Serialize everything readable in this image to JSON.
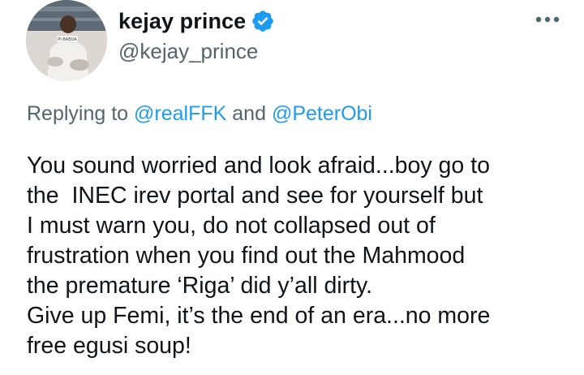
{
  "author": {
    "display_name": "kejay prince",
    "handle": "@kejay_prince",
    "verified": true,
    "verified_color": "#1d9bf0",
    "avatar_label": "PI-BABUA"
  },
  "more_menu": {
    "icon": "more-horizontal-icon"
  },
  "reply": {
    "prefix": "Replying to ",
    "mention_1": "@realFFK",
    "joiner": " and ",
    "mention_2": "@PeterObi",
    "mention_color": "#1d9bf0"
  },
  "tweet": {
    "lines": [
      "You sound worried and look afraid...boy go to",
      "the  INEC irev portal and see for yourself but",
      "I must warn you, do not collapsed out of",
      "frustration when you find out the Mahmood",
      "the premature ‘Riga’ did y’all dirty.",
      "Give up Femi, it’s the end of an era...no more",
      "free egusi soup!"
    ]
  }
}
